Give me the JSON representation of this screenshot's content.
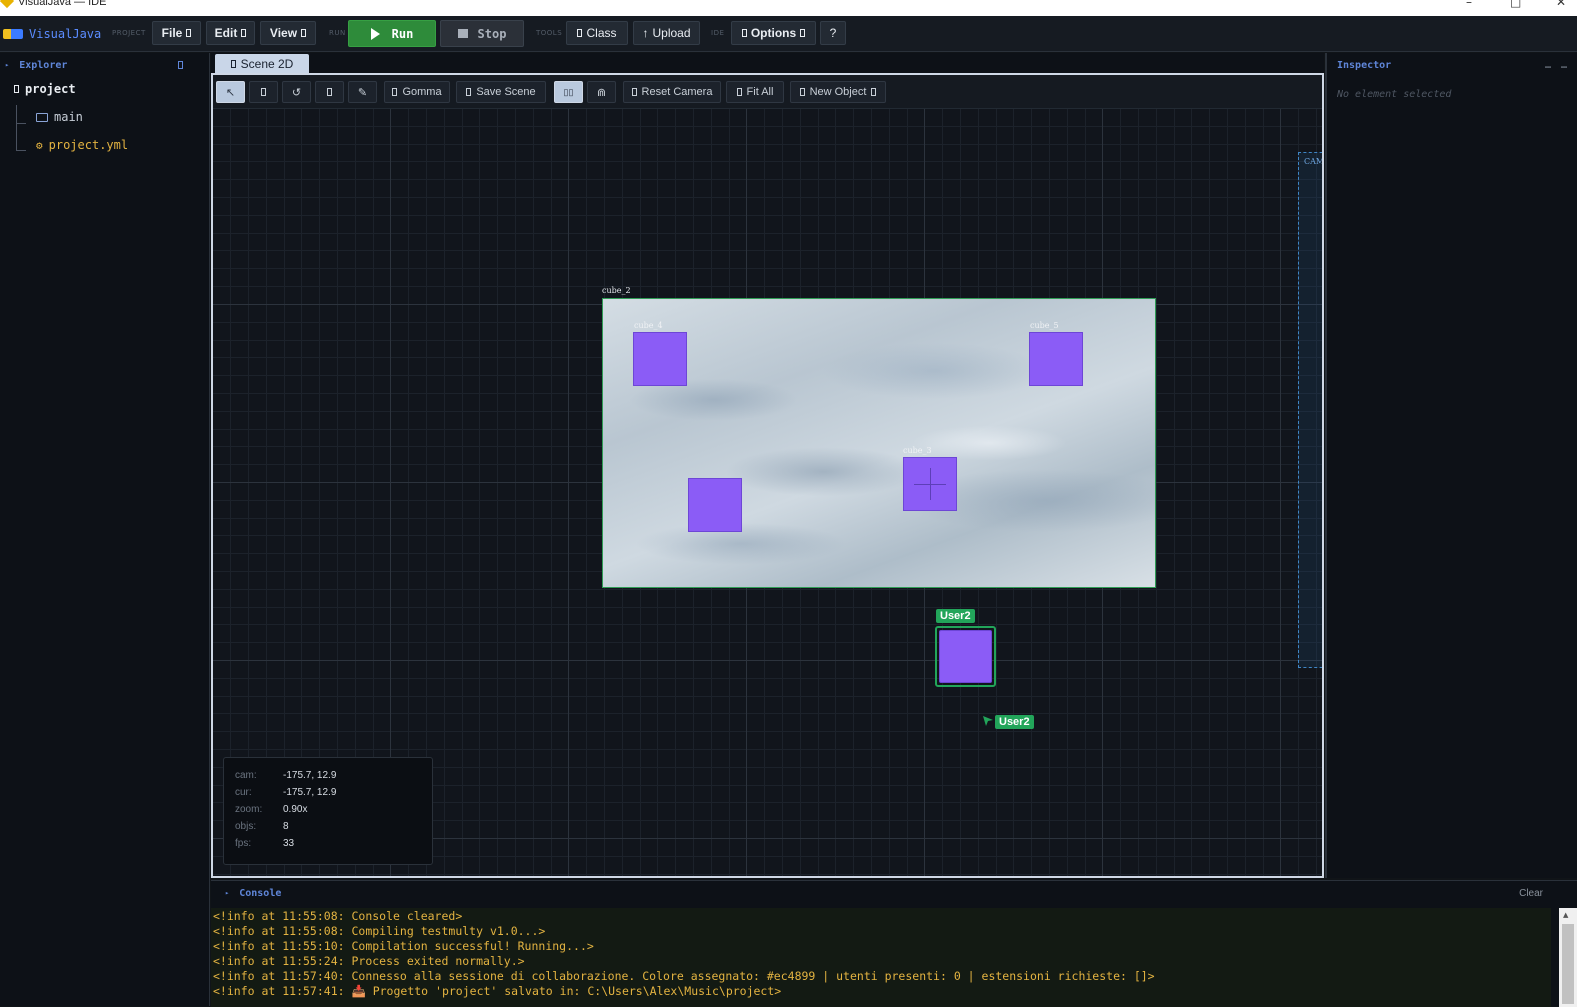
{
  "window": {
    "title": "VisualJava — IDE"
  },
  "toolbar": {
    "logo": "VisualJava",
    "group_project": "PROJECT",
    "group_run": "RUN",
    "group_tools": "TOOLS",
    "group_ide": "IDE",
    "file": "File",
    "edit": "Edit",
    "view": "View",
    "run": "Run",
    "stop": "Stop",
    "class": "Class",
    "upload": "Upload",
    "options": "Options",
    "help": "?"
  },
  "explorer": {
    "title": "Explorer",
    "root": "project",
    "items": [
      {
        "label": "main",
        "icon": "folder-icon"
      },
      {
        "label": "project.yml",
        "icon": "gear-icon"
      }
    ]
  },
  "scene": {
    "tab": "Scene 2D",
    "tools": {
      "gomma": "Gomma",
      "save": "Save Scene",
      "reset_camera": "Reset Camera",
      "fit_all": "Fit All",
      "new_object": "New Object"
    },
    "labels": {
      "cube_2": "cube_2",
      "cube_4": "cube_4",
      "cube_5": "cube_5",
      "cube_3": "cube_3",
      "camera": "CAM"
    },
    "user_badge": "User2",
    "cursor_badge": "User2",
    "hud": {
      "cam_label": "cam:",
      "cam": "-175.7, 12.9",
      "cur_label": "cur:",
      "cur": "-175.7, 12.9",
      "zoom_label": "zoom:",
      "zoom": "0.90x",
      "objs_label": "objs:",
      "objs": "8",
      "fps_label": "fps:",
      "fps": "33"
    },
    "colors": {
      "cube": "#8b5cf6",
      "selection": "#22a55a"
    }
  },
  "inspector": {
    "title": "Inspector",
    "empty": "No element selected"
  },
  "console": {
    "title": "Console",
    "clear": "Clear",
    "lines": [
      "<!info at 11:55:08: Console cleared>",
      "<!info at 11:55:08: Compiling testmulty v1.0...>",
      "<!info at 11:55:10: Compilation successful! Running...>",
      "<!info at 11:55:24: Process exited normally.>",
      "<!info at 11:57:40: Connesso alla sessione di collaborazione. Colore assegnato: #ec4899 | utenti presenti: 0 | estensioni richieste: []>",
      "<!info at 11:57:41: 📥 Progetto 'project' salvato in: C:\\Users\\Alex\\Music\\project>"
    ]
  }
}
